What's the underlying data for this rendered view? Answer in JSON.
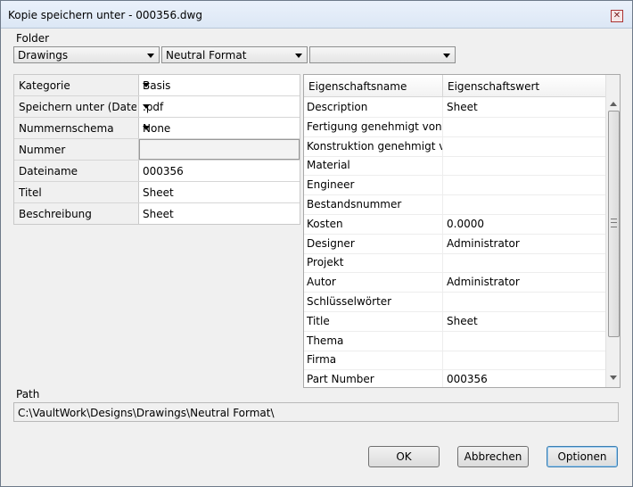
{
  "window": {
    "title": "Kopie speichern unter - 000356.dwg"
  },
  "folder": {
    "label": "Folder",
    "combo1": "Drawings",
    "combo2": "Neutral Format",
    "combo3": ""
  },
  "grid": [
    {
      "key": "Kategorie",
      "value": "Basis",
      "dropdown": true
    },
    {
      "key": "Speichern unter (Dateityp)",
      "value": ".pdf",
      "dropdown": true
    },
    {
      "key": "Nummernschema",
      "value": "None",
      "dropdown": true
    },
    {
      "key": "Nummer",
      "value": "",
      "disabled": true
    },
    {
      "key": "Dateiname",
      "value": "000356"
    },
    {
      "key": "Titel",
      "value": "Sheet"
    },
    {
      "key": "Beschreibung",
      "value": "Sheet"
    }
  ],
  "properties": {
    "header_name": "Eigenschaftsname",
    "header_value": "Eigenschaftswert",
    "rows": [
      {
        "name": "Description",
        "value": "Sheet"
      },
      {
        "name": "Fertigung genehmigt von",
        "value": ""
      },
      {
        "name": "Konstruktion genehmigt von",
        "value": ""
      },
      {
        "name": "Material",
        "value": ""
      },
      {
        "name": "Engineer",
        "value": ""
      },
      {
        "name": "Bestandsnummer",
        "value": ""
      },
      {
        "name": "Kosten",
        "value": "0.0000"
      },
      {
        "name": "Designer",
        "value": "Administrator"
      },
      {
        "name": "Projekt",
        "value": ""
      },
      {
        "name": "Autor",
        "value": "Administrator"
      },
      {
        "name": "Schlüsselwörter",
        "value": ""
      },
      {
        "name": "Title",
        "value": "Sheet"
      },
      {
        "name": "Thema",
        "value": ""
      },
      {
        "name": "Firma",
        "value": ""
      },
      {
        "name": "Part Number",
        "value": "000356"
      }
    ]
  },
  "path": {
    "label": "Path",
    "value": "C:\\VaultWork\\Designs\\Drawings\\Neutral Format\\"
  },
  "buttons": {
    "ok": "OK",
    "cancel": "Abbrechen",
    "options": "Optionen"
  }
}
